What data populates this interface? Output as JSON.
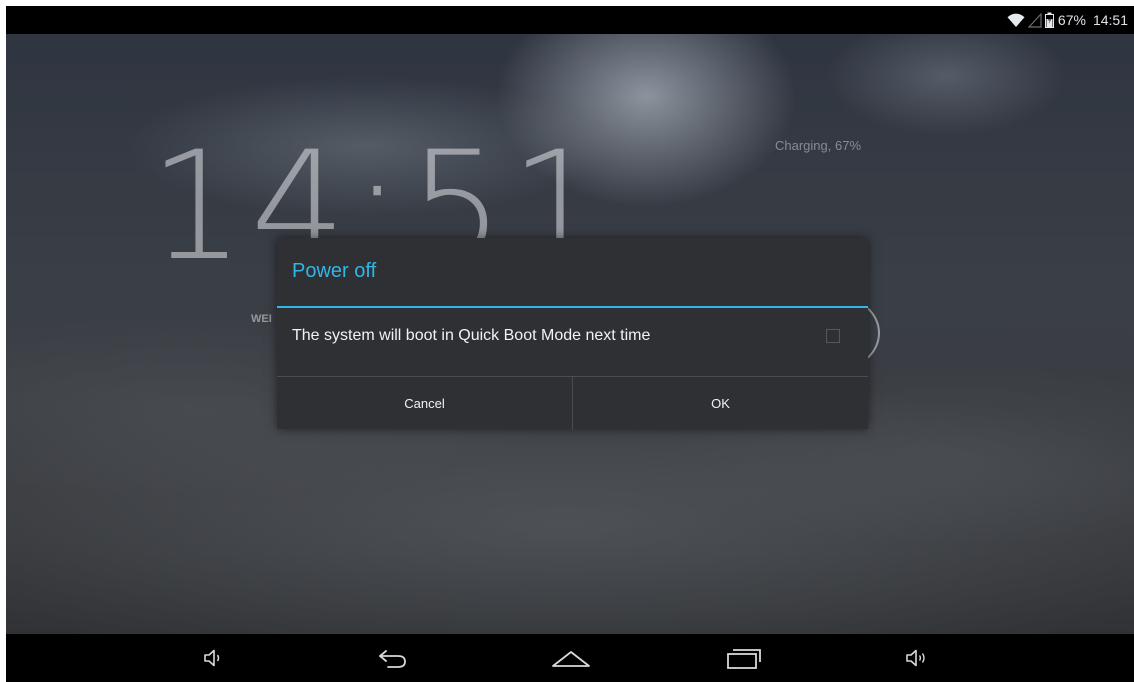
{
  "status_bar": {
    "battery_percent": "67%",
    "time": "14:51",
    "icons": [
      "wifi-icon",
      "no-signal-icon",
      "battery-icon"
    ]
  },
  "lockscreen": {
    "clock": "14:51",
    "date": "WEI",
    "charging": "Charging, 67%"
  },
  "dialog": {
    "title": "Power off",
    "message": "The system will boot in Quick Boot Mode next time",
    "checkbox_checked": false,
    "cancel_label": "Cancel",
    "ok_label": "OK",
    "accent_color": "#33b5e5"
  },
  "nav_bar": {
    "buttons": [
      "volume-down-icon",
      "back-icon",
      "home-icon",
      "recents-icon",
      "volume-up-icon"
    ]
  }
}
